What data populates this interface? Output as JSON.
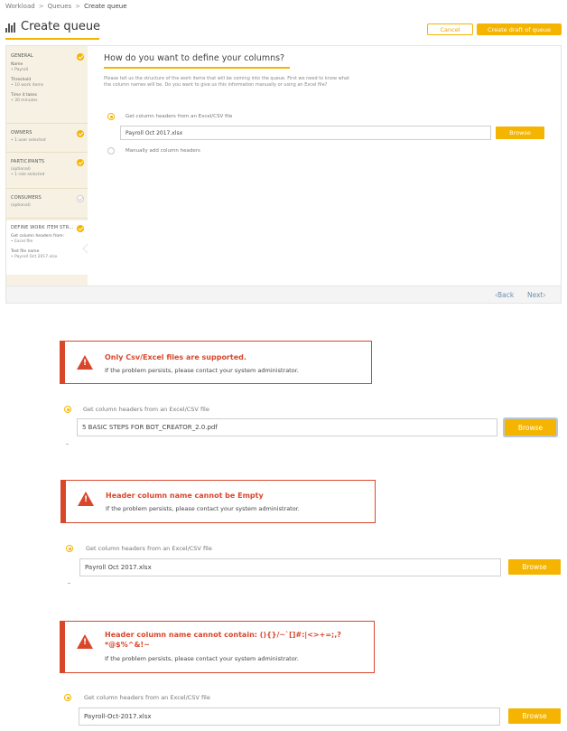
{
  "breadcrumb": {
    "items": [
      "Workload",
      "Queues",
      "Create queue"
    ],
    "separator": ">"
  },
  "header": {
    "title": "Create queue",
    "cancel_label": "Cancel",
    "draft_label": "Create draft of queue"
  },
  "sidebar": {
    "general": {
      "title": "GENERAL",
      "name_label": "Name",
      "name_value": "• Payroll",
      "threshold_label": "Threshold",
      "threshold_value": "• 10 work items",
      "time_label": "Time it takes",
      "time_value": "• 30 minutes"
    },
    "owners": {
      "title": "OWNERS",
      "value": "• 1 user selected"
    },
    "participants": {
      "title": "PARTICIPANTS",
      "sub": "(optional)",
      "value": "• 1 role selected"
    },
    "consumers": {
      "title": "CONSUMERS",
      "sub": "(optional)"
    },
    "define": {
      "title": "DEFINE WORK ITEM STR...",
      "headers_label": "Get column headers from:",
      "headers_value": "• Excel file",
      "test_label": "Test file name",
      "test_value": "• Payroll Oct 2017.xlsx"
    }
  },
  "main": {
    "question": "How do you want to define your columns?",
    "description": "Please tell us the structure of the work items that will be coming into the queue. First we need to know what the column names will be. Do you want to give us this information manually or using an Excel file?",
    "option_excel": "Get column headers from an Excel/CSV file",
    "file_value": "Payroll Oct 2017.xlsx",
    "browse_label": "Browse",
    "option_manual": "Manually add column headers",
    "back_label": "Back",
    "next_label": "Next"
  },
  "errors": [
    {
      "title": "Only Csv/Excel files are supported.",
      "subtitle": "If the problem persists, please contact your system administrator.",
      "option": "Get column headers from an Excel/CSV file",
      "file": "5 BASIC STEPS FOR BOT_CREATOR_2.0.pdf",
      "browse": "Browse"
    },
    {
      "title": "Header column name cannot be Empty",
      "subtitle": "If the problem persists, please contact your system administrator.",
      "option": "Get column headers from an Excel/CSV file",
      "file": "Payroll Oct 2017.xlsx",
      "browse": "Browse"
    },
    {
      "title_line1": "Header column name cannot contain: (){}/~`[]#:|<>+=;,?",
      "title_line2": "*@$%^&!~",
      "subtitle": "If the problem persists, please contact your system administrator.",
      "option": "Get column headers from an Excel/CSV file",
      "file": "Payroll-Oct-2017.xlsx",
      "browse": "Browse"
    }
  ],
  "colors": {
    "accent": "#f5b400",
    "error": "#d9472b",
    "sidebar_bg": "#f6f1e2",
    "link": "#6a8fb0"
  }
}
